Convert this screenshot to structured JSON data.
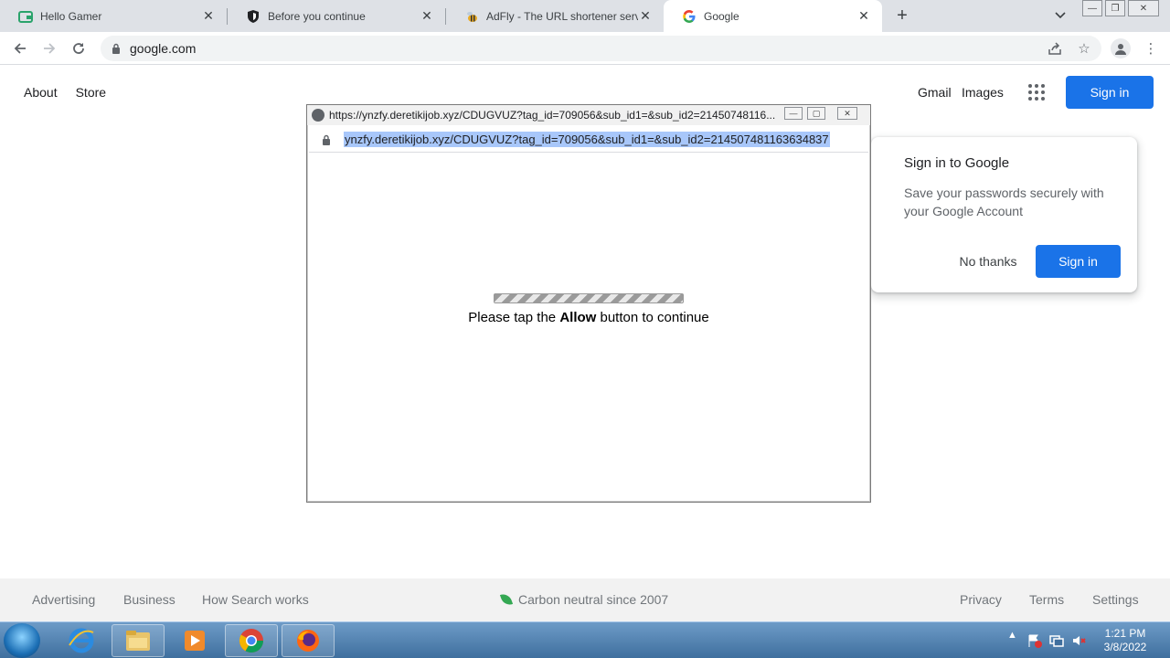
{
  "tabs": [
    {
      "title": "Hello Gamer",
      "icon": "wallet-icon"
    },
    {
      "title": "Before you continue",
      "icon": "shield-icon"
    },
    {
      "title": "AdFly - The URL shortener servic",
      "icon": "bee-icon"
    },
    {
      "title": "Google",
      "icon": "google-g-icon"
    }
  ],
  "toolbar": {
    "url": "google.com"
  },
  "google": {
    "about": "About",
    "store": "Store",
    "gmail": "Gmail",
    "images": "Images",
    "signin": "Sign in"
  },
  "signin_card": {
    "heading": "Sign in to Google",
    "body": "Save your passwords securely with your Google Account",
    "no_thanks": "No thanks",
    "signin": "Sign in"
  },
  "popup": {
    "title": "https://ynzfy.deretikijob.xyz/CDUGVUZ?tag_id=709056&sub_id1=&sub_id2=21450748116...",
    "url": "ynzfy.deretikijob.xyz/CDUGVUZ?tag_id=709056&sub_id1=&sub_id2=214507481163634837",
    "msg_prefix": "Please tap the",
    "msg_bold": "Allow",
    "msg_suffix": "button to continue"
  },
  "footer": {
    "advertising": "Advertising",
    "business": "Business",
    "how_search": "How Search works",
    "carbon": "Carbon neutral since 2007",
    "privacy": "Privacy",
    "terms": "Terms",
    "settings": "Settings"
  },
  "taskbar": {
    "time": "1:21 PM",
    "date": "3/8/2022"
  },
  "colors": {
    "accent": "#1a73e8",
    "selection": "#a8c7fa",
    "tabstrip": "#dee1e6"
  }
}
